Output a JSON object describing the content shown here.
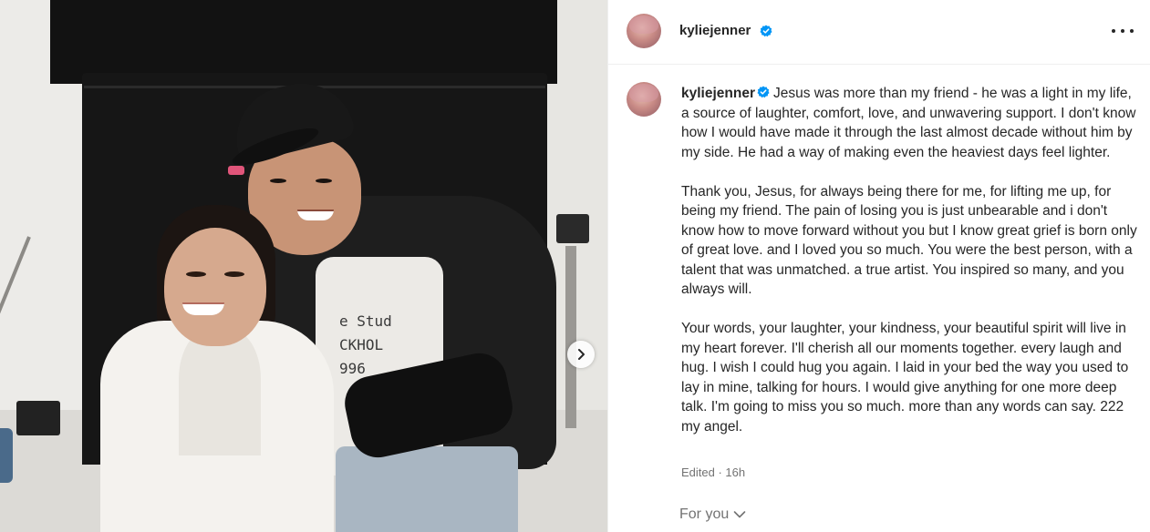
{
  "post": {
    "username": "kyliejenner",
    "verified": true,
    "caption_paragraphs": [
      "Jesus was more than my friend - he was a light in my life, a source of laughter, comfort, love, and unwavering support. I don't know how I would have made it through the last almost decade without him by my side. He had a way of making even the heaviest days feel lighter.",
      "Thank you, Jesus, for always being there for me, for lifting me up, for being my friend. The pain of losing you is just unbearable and i don't know how to move forward without you but I know great grief is born only of great love. and I loved you so much. You were the best person, with a talent that was unmatched. a true artist. You inspired so many, and you always will.",
      "Your words, your laughter, your kindness, your beautiful spirit will live in my heart forever. I'll cherish all our moments together. every laugh and hug. I wish I could hug you again. I laid in your bed the way you used to lay in mine, talking for hours. I would give anything for one more deep talk. I'm going to miss you so much. more than any words can say. 222 my angel."
    ],
    "meta": "Edited · 16h",
    "shirt_print": "e Stud\nCKHOL\n996"
  },
  "footer": {
    "for_you_label": "For you"
  },
  "icons": {
    "verified": "verified-badge-icon",
    "more": "more-options-icon",
    "next": "chevron-right-icon",
    "dropdown": "chevron-down-icon"
  },
  "colors": {
    "verified_blue": "#0095f6",
    "text": "#262626",
    "secondary_text": "#737373"
  }
}
